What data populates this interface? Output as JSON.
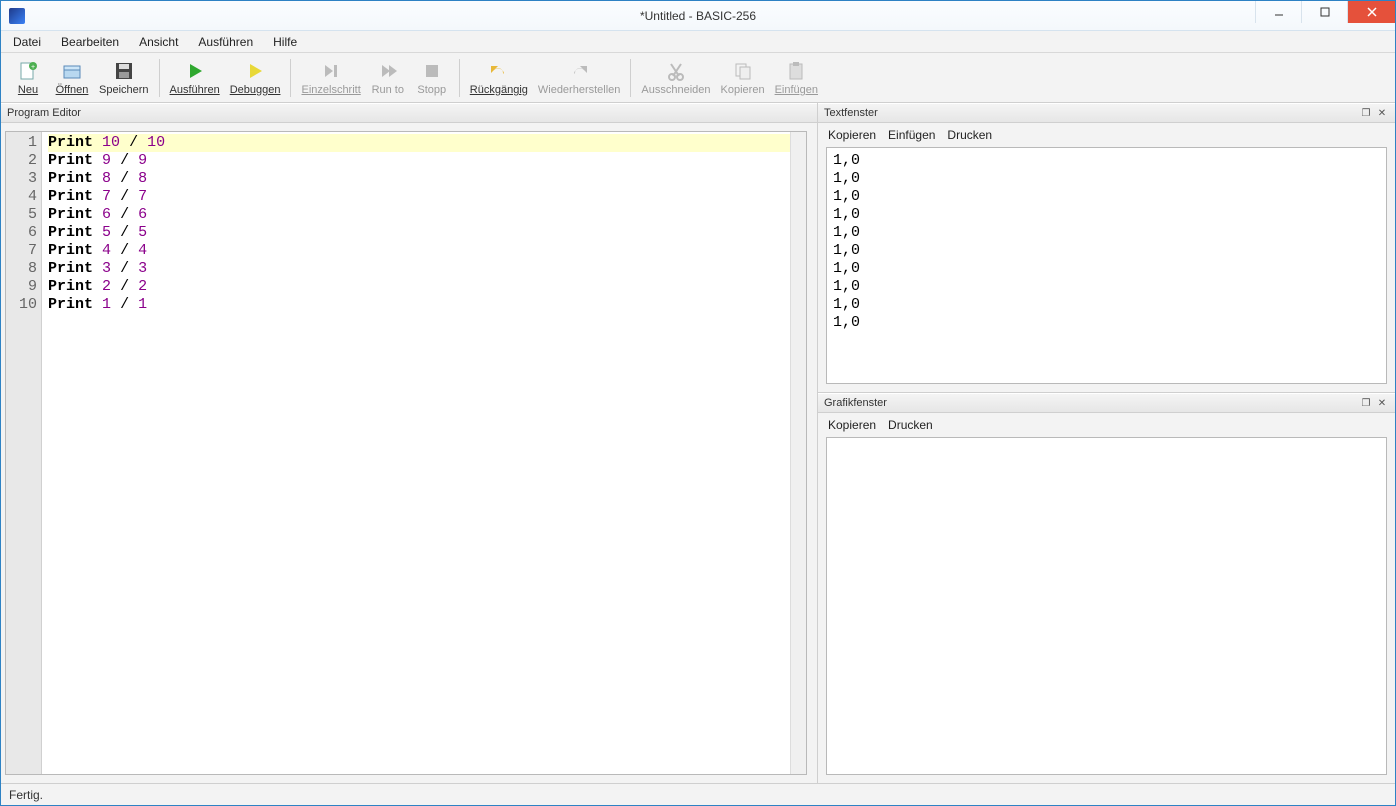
{
  "window": {
    "title": "*Untitled - BASIC-256"
  },
  "menu": {
    "items": [
      "Datei",
      "Bearbeiten",
      "Ansicht",
      "Ausführen",
      "Hilfe"
    ]
  },
  "toolbar": {
    "neu": "Neu",
    "oeffnen": "Öffnen",
    "speichern": "Speichern",
    "ausfuehren": "Ausführen",
    "debuggen": "Debuggen",
    "einzelschritt": "Einzelschritt",
    "runto": "Run to",
    "stopp": "Stopp",
    "rueckgaengig": "Rückgängig",
    "wiederherstellen": "Wiederherstellen",
    "ausschneiden": "Ausschneiden",
    "kopieren": "Kopieren",
    "einfuegen": "Einfügen"
  },
  "editor": {
    "header": "Program Editor",
    "lines": [
      {
        "n": 1,
        "kw": "Print",
        "a": "10",
        "op": "/",
        "b": "10",
        "hl": true
      },
      {
        "n": 2,
        "kw": "Print",
        "a": "9",
        "op": "/",
        "b": "9",
        "hl": false
      },
      {
        "n": 3,
        "kw": "Print",
        "a": "8",
        "op": "/",
        "b": "8",
        "hl": false
      },
      {
        "n": 4,
        "kw": "Print",
        "a": "7",
        "op": "/",
        "b": "7",
        "hl": false
      },
      {
        "n": 5,
        "kw": "Print",
        "a": "6",
        "op": "/",
        "b": "6",
        "hl": false
      },
      {
        "n": 6,
        "kw": "Print",
        "a": "5",
        "op": "/",
        "b": "5",
        "hl": false
      },
      {
        "n": 7,
        "kw": "Print",
        "a": "4",
        "op": "/",
        "b": "4",
        "hl": false
      },
      {
        "n": 8,
        "kw": "Print",
        "a": "3",
        "op": "/",
        "b": "3",
        "hl": false
      },
      {
        "n": 9,
        "kw": "Print",
        "a": "2",
        "op": "/",
        "b": "2",
        "hl": false
      },
      {
        "n": 10,
        "kw": "Print",
        "a": "1",
        "op": "/",
        "b": "1",
        "hl": false
      }
    ]
  },
  "textpanel": {
    "header": "Textfenster",
    "sub": {
      "kopieren": "Kopieren",
      "einfuegen": "Einfügen",
      "drucken": "Drucken"
    },
    "output": [
      "1,0",
      "1,0",
      "1,0",
      "1,0",
      "1,0",
      "1,0",
      "1,0",
      "1,0",
      "1,0",
      "1,0"
    ]
  },
  "gfxpanel": {
    "header": "Grafikfenster",
    "sub": {
      "kopieren": "Kopieren",
      "drucken": "Drucken"
    }
  },
  "status": "Fertig."
}
